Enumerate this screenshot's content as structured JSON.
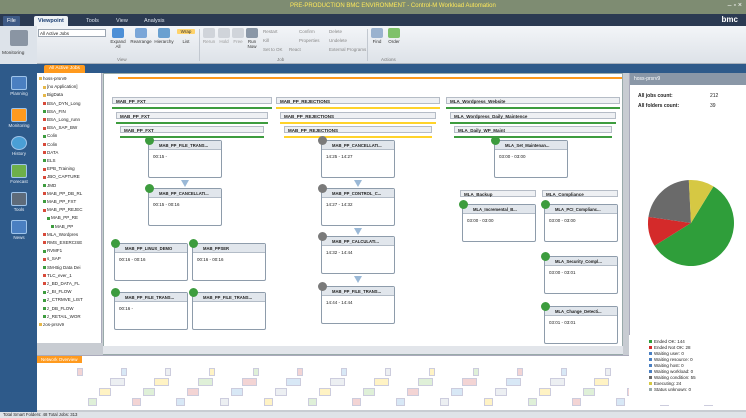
{
  "window": {
    "title": "PRE-PRODUCTION BMC ENVIRONMENT - Control-M Workload Automation",
    "controls": "– ▫ ×"
  },
  "ribbon_tabs": [
    {
      "label": "File"
    },
    {
      "label": "Viewpoint"
    },
    {
      "label": "Tools"
    },
    {
      "label": "View"
    },
    {
      "label": "Analysis"
    }
  ],
  "brand": "bmc",
  "ribbon": {
    "filter_value": "All Active Jobs",
    "expand_all": "Expand All",
    "rearrange": "Rearrange",
    "hierarchy": "Hierarchy",
    "wrap": "Wrap",
    "list": "List",
    "rerun": "Rerun",
    "hold": "Hold",
    "free": "Free",
    "run_now": "Run Now",
    "restart": "Restart",
    "kill": "Kill",
    "set_to_ok": "Set to OK",
    "react": "React",
    "confirm": "Confirm",
    "properties": "Properties",
    "delete": "Delete",
    "why": "Why",
    "undelete": "Undelete",
    "external_programs": "External Programs",
    "find": "Find",
    "order": "Order",
    "section_view": "View",
    "section_job": "Job",
    "section_actions": "Actions"
  },
  "monitoring_label": "Monitoring",
  "sidebar": [
    {
      "label": "Planning"
    },
    {
      "label": "Monitoring"
    },
    {
      "label": "History"
    },
    {
      "label": "Forecast"
    },
    {
      "label": "Tools"
    },
    {
      "label": "News"
    }
  ],
  "view_tab": "All Active Jobs",
  "tree_items": [
    {
      "label": "hoss-prsrv9"
    },
    {
      "label": "[no Application]"
    },
    {
      "label": "BigData"
    },
    {
      "label": "BSA_DYN_Long"
    },
    {
      "label": "BSA_FIN"
    },
    {
      "label": "BSA_Long_runn"
    },
    {
      "label": "BSA_SAP_BW"
    },
    {
      "label": "Colin"
    },
    {
      "label": "Colin"
    },
    {
      "label": "DATA"
    },
    {
      "label": "ELS"
    },
    {
      "label": "EPB_Training"
    },
    {
      "label": "JBO_CAPTURE"
    },
    {
      "label": "JMD"
    },
    {
      "label": "MAB_PP_DB_RL"
    },
    {
      "label": "MAB_PP_FXT"
    },
    {
      "label": "MAB_PP_REJEC"
    },
    {
      "label": "MAB_PP_RE"
    },
    {
      "label": "MAB_PP"
    },
    {
      "label": "MLA_Wordpres"
    },
    {
      "label": "RMS_EXERCISE"
    },
    {
      "label": "RVMF1"
    },
    {
      "label": "s_SAP"
    },
    {
      "label": "SM-Big Data Dei"
    },
    {
      "label": "TLC_ever_1"
    },
    {
      "label": "z_BD_DATA_FL"
    },
    {
      "label": "z_BI_FLOW"
    },
    {
      "label": "z_CTRMVE_LIST"
    },
    {
      "label": "z_DB_FLOW"
    },
    {
      "label": "z_RETAIL_WOR"
    },
    {
      "label": "zos-prsrv9"
    }
  ],
  "lanes": [
    {
      "header": "MAB_PP_FXT",
      "sub": "MAB_PP_FXT",
      "folder": "MAB_PP_FXT"
    },
    {
      "header": "MAB_PP_REJECTIONS",
      "sub": "MAB_PP_REJECTIONS",
      "folder": "MAB_PP_REJECTIONS"
    },
    {
      "header": "MLA_Wordpress_Website",
      "sub": "MLA_Wordpress_Daily_Maintence",
      "folder": "MLA_Daily_WP_Maint"
    }
  ],
  "jobs": {
    "fxt_trans": {
      "name": "MAB_PP_FILE_TRANS...",
      "time": "00:15 -"
    },
    "fxt_cancel": {
      "name": "MAB_PP_CANCELLATI...",
      "time": "00:15 - 00:16"
    },
    "fxt_linux": {
      "name": "MAB_PP_LINUX_DEMO",
      "time": "00:16 - 00:16"
    },
    "fxt_ppser": {
      "name": "MAB_PPSER",
      "time": "00:16 - 00:16"
    },
    "fxt_trans2": {
      "name": "MAB_PP_FILE_TRANS...",
      "time": "00:16 -"
    },
    "fxt_trans3": {
      "name": "MAB_PP_FILE_TRANS...",
      "time": ""
    },
    "rej_cancel": {
      "name": "MAB_PP_CANCELLATI...",
      "time": "14:25 - 14:27"
    },
    "rej_control": {
      "name": "MAB_PP_CONTROL_C...",
      "time": "14:27 - 14:32"
    },
    "rej_calc": {
      "name": "MAB_PP_CALCULATI...",
      "time": "14:32 - 14:44"
    },
    "rej_trans": {
      "name": "MAB_PP_FILE_TRANS...",
      "time": "14:44 - 14:44"
    },
    "mla_set": {
      "name": "MLA_Set_Maintenan...",
      "time": "03:00 - 03:00"
    },
    "mla_backup_folder": {
      "name": "MLA_Backup"
    },
    "mla_compliance_folder": {
      "name": "MLA_Compliance"
    },
    "mla_incr": {
      "name": "MLA_Incremental_B...",
      "time": "03:00 - 03:00"
    },
    "mla_pci": {
      "name": "MLA_PCI_Complianc...",
      "time": "03:00 - 03:00"
    },
    "mla_sec": {
      "name": "MLA_Security_Compl...",
      "time": "03:00 - 03:01"
    },
    "mla_change": {
      "name": "MLA_Change_Detecti...",
      "time": "03:01 - 03:01"
    }
  },
  "network_overview": "Network Overview",
  "right_panel": {
    "header": "hoss-prsrv9",
    "all_jobs_label": "All jobs count:",
    "all_jobs_value": "212",
    "all_folders_label": "All folders count:",
    "all_folders_value": "39"
  },
  "pie": {
    "slices": [
      {
        "label": "Ended OK",
        "value": 144,
        "color": "#2f9e3a"
      },
      {
        "label": "Ended Not OK",
        "value": 28,
        "color": "#d42a2a"
      },
      {
        "label": "Waiting workload",
        "value": 0,
        "color": "#9b5aa8"
      },
      {
        "label": "Waiting condition",
        "value": 55,
        "color": "#6a6a6a"
      },
      {
        "label": "Executing",
        "value": 24,
        "color": "#d6c843"
      }
    ]
  },
  "legend": [
    {
      "text": "Ended OK: 144",
      "color": "#2f9e3a"
    },
    {
      "text": "Ended Not OK: 28",
      "color": "#d42a2a"
    },
    {
      "text": "Waiting user: 0",
      "color": "#4a7fc1"
    },
    {
      "text": "Waiting resource: 0",
      "color": "#4a7fc1"
    },
    {
      "text": "Waiting host: 0",
      "color": "#4a7fc1"
    },
    {
      "text": "Waiting workload: 0",
      "color": "#4a7fc1"
    },
    {
      "text": "Waiting condition: 55",
      "color": "#6a6a6a"
    },
    {
      "text": "Executing: 24",
      "color": "#d6c843"
    },
    {
      "text": "Status unknown: 0",
      "color": "#9aa"
    }
  ],
  "status": "Total Smart Folders: 48   Total Jobs: 313"
}
